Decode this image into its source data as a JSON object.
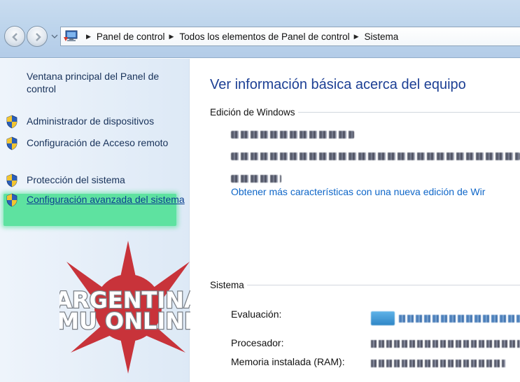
{
  "breadcrumb": [
    "Panel de control",
    "Todos los elementos de Panel de control",
    "Sistema"
  ],
  "sidebar": {
    "home_link": "Ventana principal del Panel de control",
    "tasks": [
      {
        "label": "Administrador de dispositivos",
        "icon": "uac-shield-icon"
      },
      {
        "label": "Configuración de Acceso remoto",
        "icon": "uac-shield-icon"
      },
      {
        "label": "Protección del sistema",
        "icon": "uac-shield-icon"
      },
      {
        "label": "Configuración avanzada del sistema",
        "icon": "uac-shield-icon",
        "highlighted": true,
        "highlight_color": "#5ee2a0"
      }
    ],
    "watermark_logo": {
      "line1": "ARGENTINA",
      "line2": "MU ONLINE",
      "star_color": "#c8333a"
    }
  },
  "main": {
    "title": "Ver información básica acerca del equipo",
    "edition_section": {
      "heading": "Edición de Windows",
      "upgrade_link": "Obtener más características con una nueva edición de Wir"
    },
    "system_section": {
      "heading": "Sistema",
      "properties": [
        {
          "label": "Evaluación:"
        },
        {
          "label": "Procesador:"
        },
        {
          "label": "Memoria instalada (RAM):"
        }
      ]
    }
  },
  "colors": {
    "title_blue": "#1c3f94",
    "link_blue": "#0e66c8",
    "sidebar_text": "#18325a"
  }
}
